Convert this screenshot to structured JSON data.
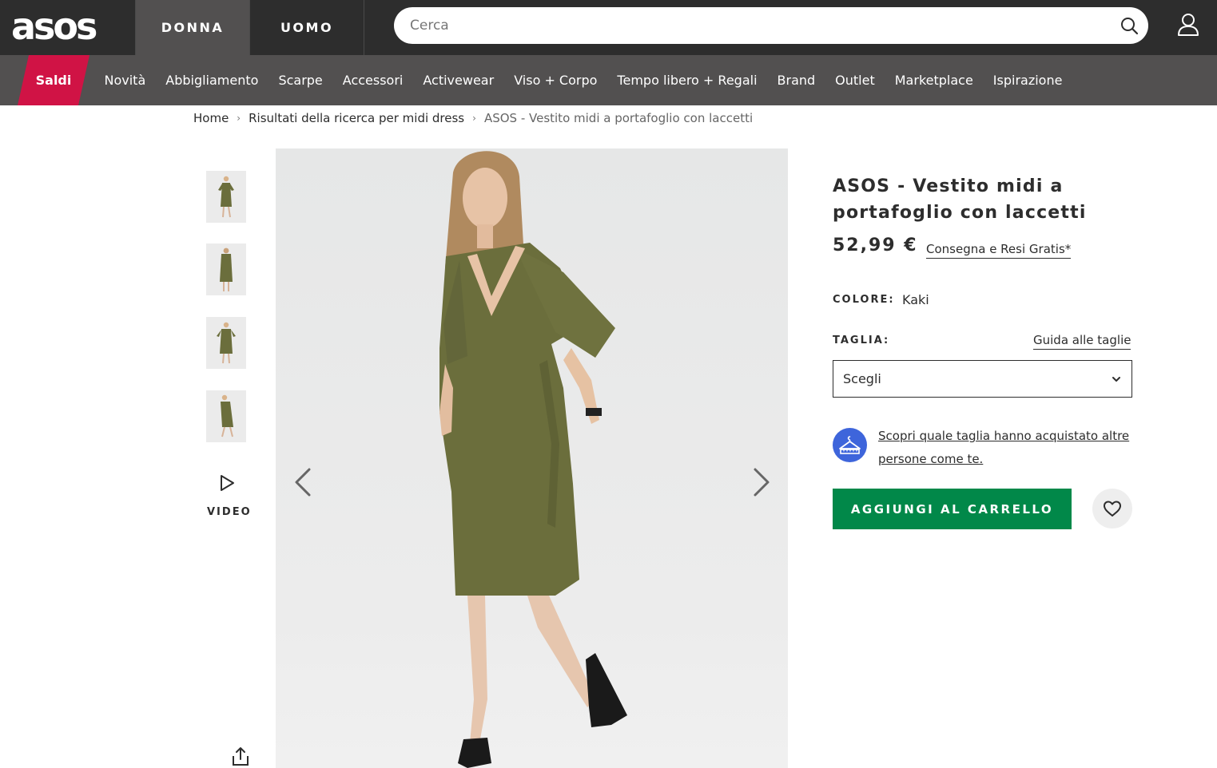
{
  "header": {
    "logo": "asos",
    "tabs": [
      "DONNA",
      "UOMO"
    ],
    "active_tab": "DONNA",
    "search": {
      "placeholder": "Cerca"
    }
  },
  "nav": {
    "sale": "Saldi",
    "items": [
      "Novità",
      "Abbigliamento",
      "Scarpe",
      "Accessori",
      "Activewear",
      "Viso + Corpo",
      "Tempo libero + Regali",
      "Brand",
      "Outlet",
      "Marketplace",
      "Ispirazione"
    ]
  },
  "breadcrumb": [
    "Home",
    "Risultati della ricerca per midi dress",
    "ASOS - Vestito midi a portafoglio con laccetti"
  ],
  "gallery": {
    "video_label": "VIDEO",
    "thumbnail_count": 4
  },
  "product": {
    "title": "ASOS - Vestito midi a portafoglio con laccetti",
    "price": "52,99 €",
    "delivery": "Consegna e Resi Gratis*",
    "colour_label": "COLORE:",
    "colour": "Kaki",
    "size_label": "TAGLIA:",
    "size_guide": "Guida alle taglie",
    "size_placeholder": "Scegli",
    "fit_assistant": "Scopri quale taglia hanno acquistato altre persone come te.",
    "add_to_bag": "AGGIUNGI AL CARRELLO"
  },
  "colors": {
    "header_bg": "#2d2d2d",
    "nav_bg": "#525050",
    "sale": "#d01345",
    "add_to_bag": "#018849",
    "fit_icon": "#3e65db",
    "dress": "#6b6e3c"
  },
  "icons": [
    "search-icon",
    "account-icon",
    "play-icon",
    "share-icon",
    "chevron-left-icon",
    "chevron-right-icon",
    "chevron-down-icon",
    "hanger-icon",
    "heart-icon"
  ]
}
